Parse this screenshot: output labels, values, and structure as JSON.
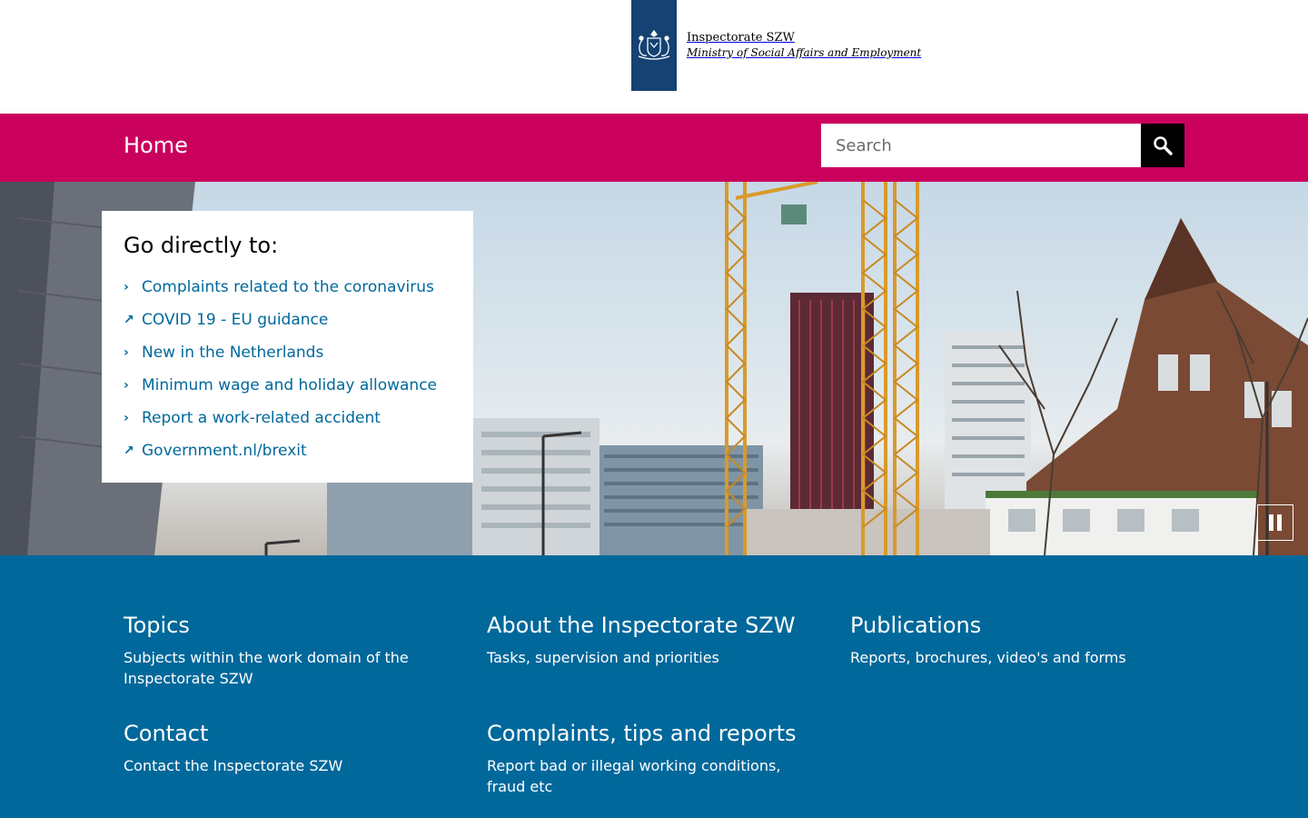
{
  "header": {
    "logo_title": "Inspectorate SZW",
    "logo_subtitle": "Ministry of Social Affairs and Employment"
  },
  "nav": {
    "home_label": "Home",
    "search_placeholder": "Search"
  },
  "goto": {
    "title": "Go directly to:",
    "items": [
      {
        "label": "Complaints related to the coronavirus",
        "type": "internal"
      },
      {
        "label": "COVID 19 - EU guidance",
        "type": "external"
      },
      {
        "label": "New in the Netherlands",
        "type": "internal"
      },
      {
        "label": "Minimum wage and holiday allowance",
        "type": "internal"
      },
      {
        "label": "Report a work-related accident",
        "type": "internal"
      },
      {
        "label": "Government.nl/brexit",
        "type": "external"
      }
    ]
  },
  "cards": [
    {
      "title": "Topics",
      "description": "Subjects within the work domain of the Inspectorate SZW"
    },
    {
      "title": "About the Inspectorate SZW",
      "description": "Tasks, supervision and priorities"
    },
    {
      "title": "Publications",
      "description": "Reports, brochures, video's and forms"
    },
    {
      "title": "Contact",
      "description": "Contact the Inspectorate SZW"
    },
    {
      "title": "Complaints, tips and reports",
      "description": "Report bad or illegal working conditions, fraud etc"
    }
  ],
  "colors": {
    "brand_navy": "#154273",
    "nav_magenta": "#ca005d",
    "link_blue": "#01689b",
    "footer_blue": "#01689b"
  },
  "icons": {
    "search": "magnifier-icon",
    "pause": "pause-icon",
    "internal_link": "chevron-right-icon",
    "external_link": "arrow-up-right-icon"
  }
}
